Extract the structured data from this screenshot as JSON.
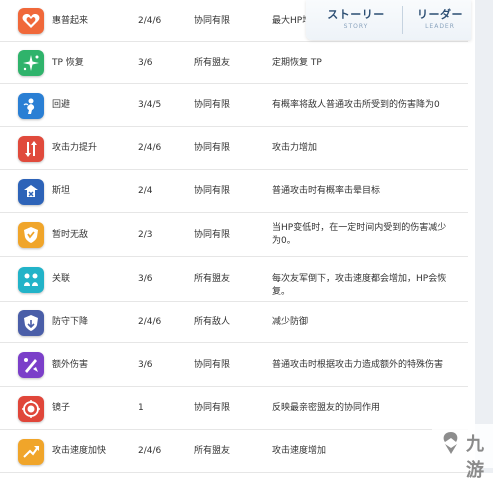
{
  "nav": {
    "story": {
      "main": "ストーリー",
      "sub": "STORY"
    },
    "leader": {
      "main": "リーダー",
      "sub": "LEADER"
    }
  },
  "rows": [
    {
      "icon": "heart-icon",
      "color": "#f0683a",
      "name": "惠普起来",
      "turns": "2/4/6",
      "target": "协同有限",
      "desc": "最大HP增加"
    },
    {
      "icon": "sparkle-icon",
      "color": "#2fb36b",
      "name": "TP 恢复",
      "turns": "3/6",
      "target": "所有盟友",
      "desc": "定期恢复 TP"
    },
    {
      "icon": "dodge-icon",
      "color": "#2a7fd4",
      "name": "回避",
      "turns": "3/4/5",
      "target": "协同有限",
      "desc": "有概率将敌人普通攻击所受到的伤害降为0"
    },
    {
      "icon": "attack-up-icon",
      "color": "#e04a3c",
      "name": "攻击力提升",
      "turns": "2/4/6",
      "target": "协同有限",
      "desc": "攻击力增加"
    },
    {
      "icon": "break-icon",
      "color": "#2d63b8",
      "name": "斯坦",
      "turns": "2/4",
      "target": "协同有限",
      "desc": "普通攻击时有概率击晕目标"
    },
    {
      "icon": "shield-hand-icon",
      "color": "#f0a52a",
      "name": "暂时无敌",
      "turns": "2/3",
      "target": "协同有限",
      "desc": "当HP变低时，在一定时间内受到的伤害减少为0。"
    },
    {
      "icon": "bond-icon",
      "color": "#22b3c8",
      "name": "关联",
      "turns": "3/6",
      "target": "所有盟友",
      "desc": "每次友军倒下，攻击速度都会增加，HP会恢复。"
    },
    {
      "icon": "defense-down-icon",
      "color": "#4a5ea8",
      "name": "防守下降",
      "turns": "2/4/6",
      "target": "所有敌人",
      "desc": "减少防御"
    },
    {
      "icon": "extra-damage-icon",
      "color": "#7b3fc9",
      "name": "额外伤害",
      "turns": "3/6",
      "target": "协同有限",
      "desc": "普通攻击时根据攻击力造成额外的特殊伤害"
    },
    {
      "icon": "mirror-icon",
      "color": "#e0463a",
      "name": "镜子",
      "turns": "1",
      "target": "协同有限",
      "desc": "反映最亲密盟友的协同作用"
    },
    {
      "icon": "speed-up-icon",
      "color": "#f0a52a",
      "name": "攻击速度加快",
      "turns": "2/4/6",
      "target": "所有盟友",
      "desc": "攻击速度增加"
    }
  ],
  "watermark": "九游"
}
